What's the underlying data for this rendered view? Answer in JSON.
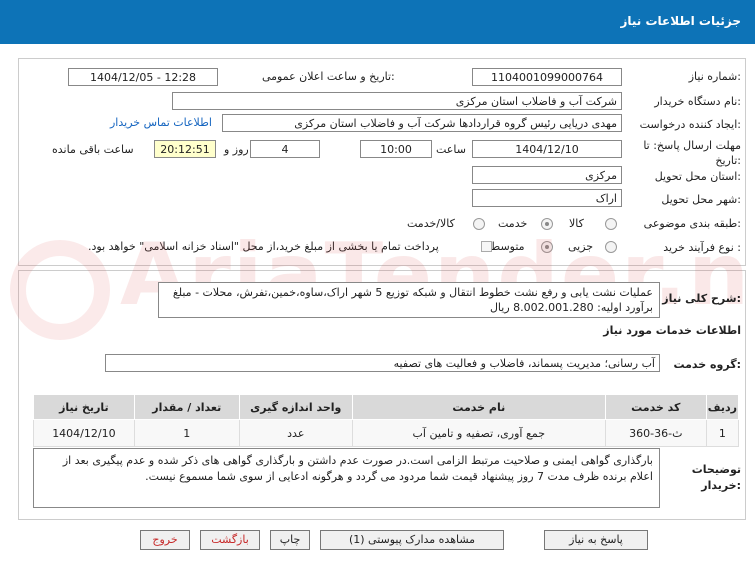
{
  "header": {
    "title": "جزئیات اطلاعات نیاز"
  },
  "watermark": {
    "text": "AriaTender.net"
  },
  "form": {
    "need_number_label": "شماره نیاز:",
    "need_number": "1104001099000764",
    "announce_label": "تاریخ و ساعت اعلان عمومی:",
    "announce_value": "1404/12/05 - 12:28",
    "buyer_org_label": "نام دستگاه خریدار:",
    "buyer_org": "شرکت آب و فاضلاب استان مرکزی",
    "creator_label": "ایجاد کننده درخواست:",
    "creator": "مهدی دریایی رئیس گروه قراردادها شرکت آب و فاضلاب استان مرکزی",
    "contact_link": "اطلاعات تماس خریدار",
    "deadline_label": "مهلت ارسال پاسخ: تا تاریخ:",
    "deadline_date": "1404/12/10",
    "time_label": "ساعت",
    "deadline_time": "10:00",
    "days_value": "4",
    "days_label": "روز و",
    "remaining_time": "20:12:51",
    "remaining_label": "ساعت باقی مانده",
    "province_label": "استان محل تحویل:",
    "province": "مرکزی",
    "city_label": "شهر محل تحویل:",
    "city": "اراک",
    "category_label": "طبقه بندی موضوعی:",
    "category_options": [
      "کالا",
      "خدمت",
      "کالا/خدمت"
    ],
    "category_selected": "خدمت",
    "process_label": "نوع فرآیند خرید :",
    "process_options": [
      "جزیی",
      "متوسط"
    ],
    "process_selected": "متوسط",
    "payment_note": "پرداخت تمام یا بخشی از مبلغ خرید،از محل \"اسناد خزانه اسلامی\" خواهد بود."
  },
  "details": {
    "summary_label": "شرح کلی نیاز:",
    "summary": "عملیات نشت یابی و رفع نشت خطوط انتقال و شبکه توزیع 5 شهر اراک،ساوه،خمین،تفرش، محلات - مبلغ برآورد اولیه: 8.002.001.280 ریال",
    "services_heading": "اطلاعات خدمات مورد نیاز",
    "service_group_label": "گروه خدمت:",
    "service_group": "آب رسانی؛ مدیریت پسماند، فاضلاب و فعالیت های تصفیه",
    "table": {
      "headers": [
        "ردیف",
        "کد خدمت",
        "نام خدمت",
        "واحد اندازه گیری",
        "تعداد / مقدار",
        "تاریخ نیاز"
      ],
      "rows": [
        [
          "1",
          "ث-36-360",
          "جمع آوری، تصفیه و تامین آب",
          "عدد",
          "1",
          "1404/12/10"
        ]
      ]
    },
    "buyer_notes_label": "توضیحات خریدار:",
    "buyer_notes": "بارگذاری گواهی ایمنی و صلاحیت مرتبط الزامی است.در صورت عدم داشتن و بارگذاری گواهی های ذکر شده و عدم پیگیری بعد از اعلام برنده ظرف مدت 7 روز پیشنهاد قیمت شما مردود می گردد و هرگونه ادعایی از سوی شما مسموع نیست."
  },
  "buttons": {
    "reply": "پاسخ به نیاز",
    "attachments": "مشاهده مدارک پیوستی (1)",
    "print": "چاپ",
    "back": "بازگشت",
    "exit": "خروج"
  }
}
